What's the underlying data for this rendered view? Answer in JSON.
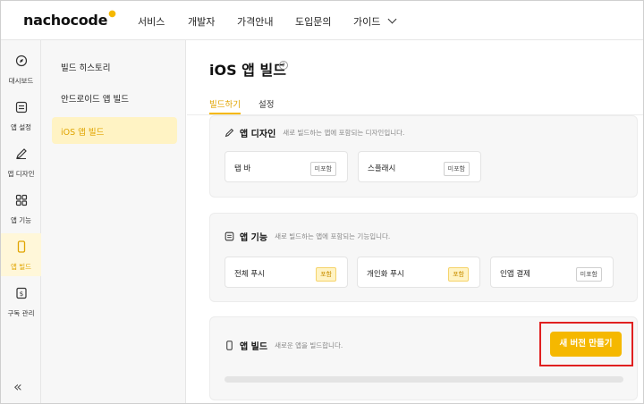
{
  "header": {
    "logo": "nachocode",
    "nav": [
      "서비스",
      "개발자",
      "가격안내",
      "도입문의",
      "가이드"
    ]
  },
  "rail": {
    "items": [
      {
        "label": "대시보드",
        "icon": "compass-icon"
      },
      {
        "label": "앱 설정",
        "icon": "settings-icon"
      },
      {
        "label": "앱 디자인",
        "icon": "pencil-icon"
      },
      {
        "label": "앱 기능",
        "icon": "grid-icon"
      },
      {
        "label": "앱 빌드",
        "icon": "phone-icon"
      },
      {
        "label": "구독 관리",
        "icon": "billing-icon"
      }
    ],
    "active_index": 4,
    "collapse": "«"
  },
  "subnav": {
    "items": [
      "빌드 히스토리",
      "안드로이드 앱 빌드",
      "iOS 앱 빌드"
    ],
    "active_index": 2
  },
  "page": {
    "title": "iOS 앱 빌드",
    "help": "?",
    "tabs": [
      "빌드하기",
      "설정"
    ]
  },
  "design_card": {
    "title": "앱 디자인",
    "desc": "새로 빌드하는 앱에 포함되는 디자인입니다.",
    "items": [
      {
        "name": "탭 바",
        "badge": "미포함"
      },
      {
        "name": "스플래시",
        "badge": "미포함"
      }
    ]
  },
  "feature_card": {
    "title": "앱 기능",
    "desc": "새로 빌드하는 앱에 포함되는 기능입니다.",
    "items": [
      {
        "name": "전체 푸시",
        "badge": "포함"
      },
      {
        "name": "개인화 푸시",
        "badge": "포함"
      },
      {
        "name": "인앱 결제",
        "badge": "미포함"
      }
    ]
  },
  "build_card": {
    "title": "앱 빌드",
    "desc": "새로운 앱을 빌드합니다.",
    "button": "새 버전 만들기",
    "progress": 0
  },
  "colors": {
    "accent": "#f5b800",
    "highlight": "#e02020"
  }
}
